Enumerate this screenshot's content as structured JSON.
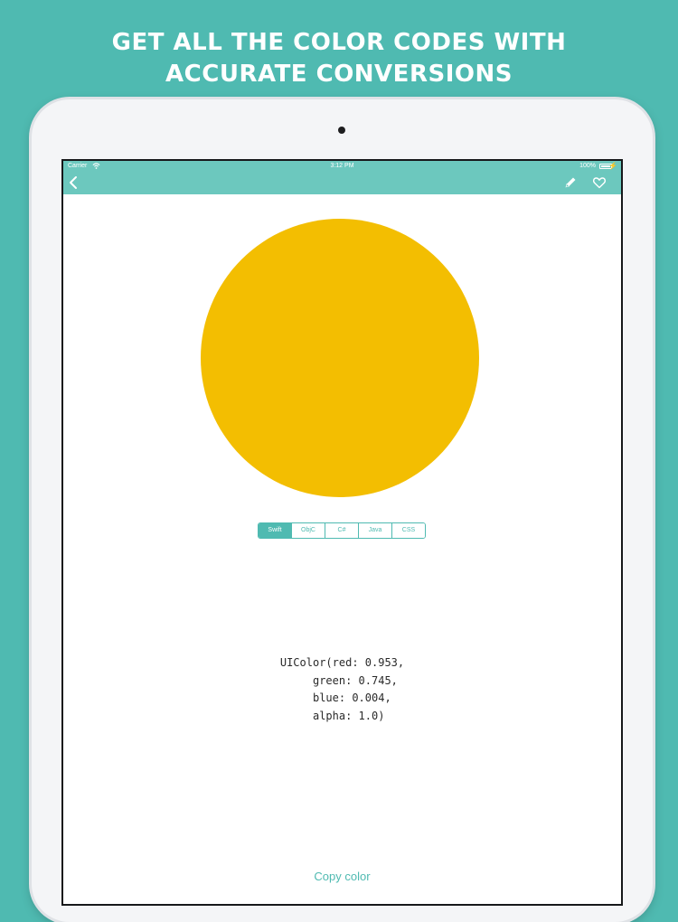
{
  "promo": {
    "headline_line1": "GET ALL THE COLOR CODES WITH",
    "headline_line2": "ACCURATE CONVERSIONS"
  },
  "status_bar": {
    "carrier": "Carrier",
    "time": "3:12 PM",
    "battery": "100%"
  },
  "nav": {
    "back_icon": "chevron-left-icon",
    "edit_icon": "pencil-icon",
    "favorite_icon": "heart-icon"
  },
  "swatch": {
    "color": "#f3be01"
  },
  "format_tabs": {
    "items": [
      "Swift",
      "ObjC",
      "C#",
      "Java",
      "CSS"
    ],
    "selected": "Swift"
  },
  "code_output": "UIColor(red: 0.953,\n     green: 0.745,\n     blue: 0.004,\n     alpha: 1.0)",
  "copy_button_label": "Copy color",
  "colors": {
    "background": "#4fbab1",
    "navbar": "#6cc8be",
    "accent": "#4fbab1"
  }
}
